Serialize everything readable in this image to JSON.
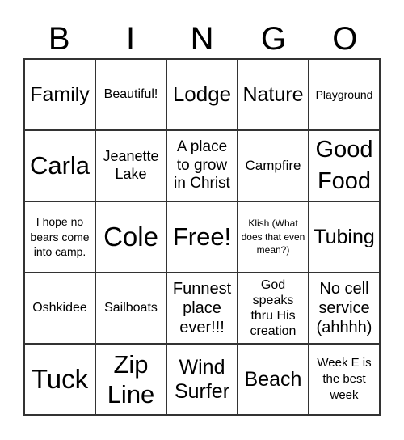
{
  "header": [
    "B",
    "I",
    "N",
    "G",
    "O"
  ],
  "cells": [
    "Family",
    "Beautiful!",
    "Lodge",
    "Nature",
    "Playground",
    "Carla",
    "Jeanette Lake",
    "A place to grow in Christ",
    "Campfire",
    "Good Food",
    "I hope no bears come into camp.",
    "Cole",
    "Free!",
    "Klish (What does that even mean?)",
    "Tubing",
    "Oshkidee",
    "Sailboats",
    "Funnest place ever!!!",
    "God speaks thru His creation",
    "No cell service (ahhhh)",
    "Tuck",
    "Zip Line",
    "Wind Surfer",
    "Beach",
    "Week E is the best week"
  ]
}
